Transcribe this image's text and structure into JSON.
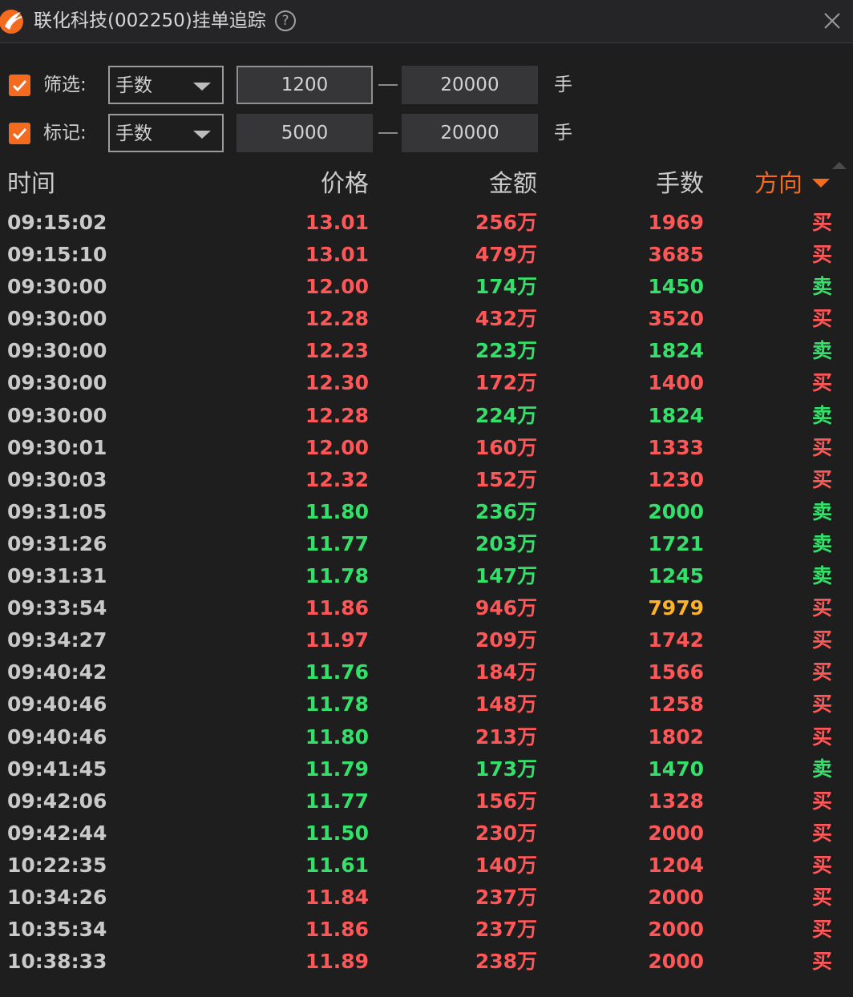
{
  "window": {
    "title": "联化科技(002250)挂单追踪",
    "help_label": "?"
  },
  "filters": [
    {
      "checked": true,
      "label": "筛选:",
      "select_value": "手数",
      "min": "1200",
      "max": "20000",
      "unit": "手"
    },
    {
      "checked": true,
      "label": "标记:",
      "select_value": "手数",
      "min": "5000",
      "max": "20000",
      "unit": "手"
    }
  ],
  "table": {
    "headers": {
      "time": "时间",
      "price": "价格",
      "amount": "金额",
      "volume": "手数",
      "direction": "方向"
    },
    "sorted_by": "direction",
    "rows": [
      {
        "time": "09:15:02",
        "price": "13.01",
        "amount": "256万",
        "volume": "1969",
        "direction": "买",
        "price_color": "red",
        "amount_color": "red",
        "volume_color": "red",
        "dir_color": "red"
      },
      {
        "time": "09:15:10",
        "price": "13.01",
        "amount": "479万",
        "volume": "3685",
        "direction": "买",
        "price_color": "red",
        "amount_color": "red",
        "volume_color": "red",
        "dir_color": "red"
      },
      {
        "time": "09:30:00",
        "price": "12.00",
        "amount": "174万",
        "volume": "1450",
        "direction": "卖",
        "price_color": "red",
        "amount_color": "green",
        "volume_color": "green",
        "dir_color": "green"
      },
      {
        "time": "09:30:00",
        "price": "12.28",
        "amount": "432万",
        "volume": "3520",
        "direction": "买",
        "price_color": "red",
        "amount_color": "red",
        "volume_color": "red",
        "dir_color": "red"
      },
      {
        "time": "09:30:00",
        "price": "12.23",
        "amount": "223万",
        "volume": "1824",
        "direction": "卖",
        "price_color": "red",
        "amount_color": "green",
        "volume_color": "green",
        "dir_color": "green"
      },
      {
        "time": "09:30:00",
        "price": "12.30",
        "amount": "172万",
        "volume": "1400",
        "direction": "买",
        "price_color": "red",
        "amount_color": "red",
        "volume_color": "red",
        "dir_color": "red"
      },
      {
        "time": "09:30:00",
        "price": "12.28",
        "amount": "224万",
        "volume": "1824",
        "direction": "卖",
        "price_color": "red",
        "amount_color": "green",
        "volume_color": "green",
        "dir_color": "green"
      },
      {
        "time": "09:30:01",
        "price": "12.00",
        "amount": "160万",
        "volume": "1333",
        "direction": "买",
        "price_color": "red",
        "amount_color": "red",
        "volume_color": "red",
        "dir_color": "red"
      },
      {
        "time": "09:30:03",
        "price": "12.32",
        "amount": "152万",
        "volume": "1230",
        "direction": "买",
        "price_color": "red",
        "amount_color": "red",
        "volume_color": "red",
        "dir_color": "red"
      },
      {
        "time": "09:31:05",
        "price": "11.80",
        "amount": "236万",
        "volume": "2000",
        "direction": "卖",
        "price_color": "green",
        "amount_color": "green",
        "volume_color": "green",
        "dir_color": "green"
      },
      {
        "time": "09:31:26",
        "price": "11.77",
        "amount": "203万",
        "volume": "1721",
        "direction": "卖",
        "price_color": "green",
        "amount_color": "green",
        "volume_color": "green",
        "dir_color": "green"
      },
      {
        "time": "09:31:31",
        "price": "11.78",
        "amount": "147万",
        "volume": "1245",
        "direction": "卖",
        "price_color": "green",
        "amount_color": "green",
        "volume_color": "green",
        "dir_color": "green"
      },
      {
        "time": "09:33:54",
        "price": "11.86",
        "amount": "946万",
        "volume": "7979",
        "direction": "买",
        "price_color": "red",
        "amount_color": "red",
        "volume_color": "yellow",
        "dir_color": "red"
      },
      {
        "time": "09:34:27",
        "price": "11.97",
        "amount": "209万",
        "volume": "1742",
        "direction": "买",
        "price_color": "red",
        "amount_color": "red",
        "volume_color": "red",
        "dir_color": "red"
      },
      {
        "time": "09:40:42",
        "price": "11.76",
        "amount": "184万",
        "volume": "1566",
        "direction": "买",
        "price_color": "green",
        "amount_color": "red",
        "volume_color": "red",
        "dir_color": "red"
      },
      {
        "time": "09:40:46",
        "price": "11.78",
        "amount": "148万",
        "volume": "1258",
        "direction": "买",
        "price_color": "green",
        "amount_color": "red",
        "volume_color": "red",
        "dir_color": "red"
      },
      {
        "time": "09:40:46",
        "price": "11.80",
        "amount": "213万",
        "volume": "1802",
        "direction": "买",
        "price_color": "green",
        "amount_color": "red",
        "volume_color": "red",
        "dir_color": "red"
      },
      {
        "time": "09:41:45",
        "price": "11.79",
        "amount": "173万",
        "volume": "1470",
        "direction": "卖",
        "price_color": "green",
        "amount_color": "green",
        "volume_color": "green",
        "dir_color": "green"
      },
      {
        "time": "09:42:06",
        "price": "11.77",
        "amount": "156万",
        "volume": "1328",
        "direction": "买",
        "price_color": "green",
        "amount_color": "red",
        "volume_color": "red",
        "dir_color": "red"
      },
      {
        "time": "09:42:44",
        "price": "11.50",
        "amount": "230万",
        "volume": "2000",
        "direction": "买",
        "price_color": "green",
        "amount_color": "red",
        "volume_color": "red",
        "dir_color": "red"
      },
      {
        "time": "10:22:35",
        "price": "11.61",
        "amount": "140万",
        "volume": "1204",
        "direction": "买",
        "price_color": "green",
        "amount_color": "red",
        "volume_color": "red",
        "dir_color": "red"
      },
      {
        "time": "10:34:26",
        "price": "11.84",
        "amount": "237万",
        "volume": "2000",
        "direction": "买",
        "price_color": "red",
        "amount_color": "red",
        "volume_color": "red",
        "dir_color": "red"
      },
      {
        "time": "10:35:34",
        "price": "11.86",
        "amount": "237万",
        "volume": "2000",
        "direction": "买",
        "price_color": "red",
        "amount_color": "red",
        "volume_color": "red",
        "dir_color": "red"
      },
      {
        "time": "10:38:33",
        "price": "11.89",
        "amount": "238万",
        "volume": "2000",
        "direction": "买",
        "price_color": "red",
        "amount_color": "red",
        "volume_color": "red",
        "dir_color": "red"
      }
    ]
  },
  "colors": {
    "accent": "#f46a1e",
    "up_red": "#ff5757",
    "down_green": "#35e06a",
    "highlight_yellow": "#ffb327",
    "background": "#1e1e1f"
  },
  "icons": {
    "logo": "app-logo-icon",
    "help": "help-circle-icon",
    "close": "close-icon",
    "checkbox": "checkmark-icon",
    "dropdown": "chevron-down-icon",
    "sort": "sort-desc-icon"
  }
}
